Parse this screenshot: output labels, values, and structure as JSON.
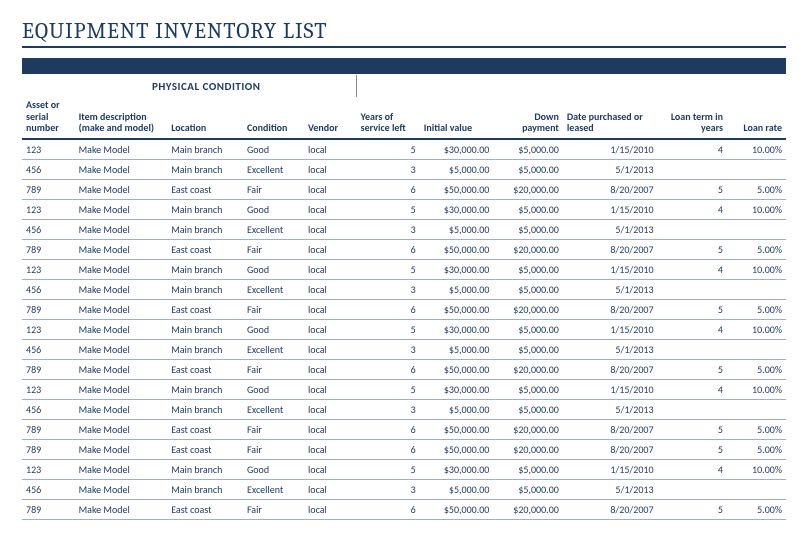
{
  "title": "EQUIPMENT INVENTORY LIST",
  "section_label": "PHYSICAL CONDITION",
  "headers": {
    "asset": "Asset or serial number",
    "desc": "Item description (make and model)",
    "location": "Location",
    "condition": "Condition",
    "vendor": "Vendor",
    "years": "Years of service left",
    "initval": "Initial value",
    "down": "Down payment",
    "date": "Date purchased or leased",
    "term": "Loan term in years",
    "rate": "Loan rate"
  },
  "rows": [
    {
      "asset": "123",
      "desc": "Make Model",
      "location": "Main branch",
      "condition": "Good",
      "vendor": "local",
      "years": "5",
      "initval": "$30,000.00",
      "down": "$5,000.00",
      "date": "1/15/2010",
      "term": "4",
      "rate": "10.00%"
    },
    {
      "asset": "456",
      "desc": "Make Model",
      "location": "Main branch",
      "condition": "Excellent",
      "vendor": "local",
      "years": "3",
      "initval": "$5,000.00",
      "down": "$5,000.00",
      "date": "5/1/2013",
      "term": "",
      "rate": ""
    },
    {
      "asset": "789",
      "desc": "Make Model",
      "location": "East coast",
      "condition": "Fair",
      "vendor": "local",
      "years": "6",
      "initval": "$50,000.00",
      "down": "$20,000.00",
      "date": "8/20/2007",
      "term": "5",
      "rate": "5.00%"
    },
    {
      "asset": "123",
      "desc": "Make Model",
      "location": "Main branch",
      "condition": "Good",
      "vendor": "local",
      "years": "5",
      "initval": "$30,000.00",
      "down": "$5,000.00",
      "date": "1/15/2010",
      "term": "4",
      "rate": "10.00%"
    },
    {
      "asset": "456",
      "desc": "Make Model",
      "location": "Main branch",
      "condition": "Excellent",
      "vendor": "local",
      "years": "3",
      "initval": "$5,000.00",
      "down": "$5,000.00",
      "date": "5/1/2013",
      "term": "",
      "rate": ""
    },
    {
      "asset": "789",
      "desc": "Make Model",
      "location": "East coast",
      "condition": "Fair",
      "vendor": "local",
      "years": "6",
      "initval": "$50,000.00",
      "down": "$20,000.00",
      "date": "8/20/2007",
      "term": "5",
      "rate": "5.00%"
    },
    {
      "asset": "123",
      "desc": "Make Model",
      "location": "Main branch",
      "condition": "Good",
      "vendor": "local",
      "years": "5",
      "initval": "$30,000.00",
      "down": "$5,000.00",
      "date": "1/15/2010",
      "term": "4",
      "rate": "10.00%"
    },
    {
      "asset": "456",
      "desc": "Make Model",
      "location": "Main branch",
      "condition": "Excellent",
      "vendor": "local",
      "years": "3",
      "initval": "$5,000.00",
      "down": "$5,000.00",
      "date": "5/1/2013",
      "term": "",
      "rate": ""
    },
    {
      "asset": "789",
      "desc": "Make Model",
      "location": "East coast",
      "condition": "Fair",
      "vendor": "local",
      "years": "6",
      "initval": "$50,000.00",
      "down": "$20,000.00",
      "date": "8/20/2007",
      "term": "5",
      "rate": "5.00%"
    },
    {
      "asset": "123",
      "desc": "Make Model",
      "location": "Main branch",
      "condition": "Good",
      "vendor": "local",
      "years": "5",
      "initval": "$30,000.00",
      "down": "$5,000.00",
      "date": "1/15/2010",
      "term": "4",
      "rate": "10.00%"
    },
    {
      "asset": "456",
      "desc": "Make Model",
      "location": "Main branch",
      "condition": "Excellent",
      "vendor": "local",
      "years": "3",
      "initval": "$5,000.00",
      "down": "$5,000.00",
      "date": "5/1/2013",
      "term": "",
      "rate": ""
    },
    {
      "asset": "789",
      "desc": "Make Model",
      "location": "East coast",
      "condition": "Fair",
      "vendor": "local",
      "years": "6",
      "initval": "$50,000.00",
      "down": "$20,000.00",
      "date": "8/20/2007",
      "term": "5",
      "rate": "5.00%"
    },
    {
      "asset": "123",
      "desc": "Make Model",
      "location": "Main branch",
      "condition": "Good",
      "vendor": "local",
      "years": "5",
      "initval": "$30,000.00",
      "down": "$5,000.00",
      "date": "1/15/2010",
      "term": "4",
      "rate": "10.00%"
    },
    {
      "asset": "456",
      "desc": "Make Model",
      "location": "Main branch",
      "condition": "Excellent",
      "vendor": "local",
      "years": "3",
      "initval": "$5,000.00",
      "down": "$5,000.00",
      "date": "5/1/2013",
      "term": "",
      "rate": ""
    },
    {
      "asset": "789",
      "desc": "Make Model",
      "location": "East coast",
      "condition": "Fair",
      "vendor": "local",
      "years": "6",
      "initval": "$50,000.00",
      "down": "$20,000.00",
      "date": "8/20/2007",
      "term": "5",
      "rate": "5.00%"
    },
    {
      "asset": "789",
      "desc": "Make Model",
      "location": "East coast",
      "condition": "Fair",
      "vendor": "local",
      "years": "6",
      "initval": "$50,000.00",
      "down": "$20,000.00",
      "date": "8/20/2007",
      "term": "5",
      "rate": "5.00%"
    },
    {
      "asset": "123",
      "desc": "Make Model",
      "location": "Main branch",
      "condition": "Good",
      "vendor": "local",
      "years": "5",
      "initval": "$30,000.00",
      "down": "$5,000.00",
      "date": "1/15/2010",
      "term": "4",
      "rate": "10.00%"
    },
    {
      "asset": "456",
      "desc": "Make Model",
      "location": "Main branch",
      "condition": "Excellent",
      "vendor": "local",
      "years": "3",
      "initval": "$5,000.00",
      "down": "$5,000.00",
      "date": "5/1/2013",
      "term": "",
      "rate": ""
    },
    {
      "asset": "789",
      "desc": "Make Model",
      "location": "East coast",
      "condition": "Fair",
      "vendor": "local",
      "years": "6",
      "initval": "$50,000.00",
      "down": "$20,000.00",
      "date": "8/20/2007",
      "term": "5",
      "rate": "5.00%"
    }
  ]
}
